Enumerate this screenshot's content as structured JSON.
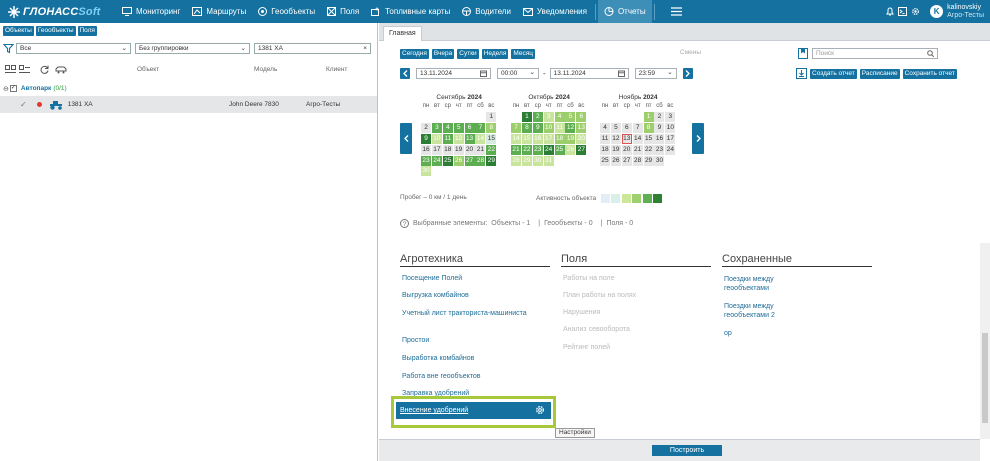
{
  "brand": {
    "name_a": "ГЛОНАСС",
    "name_b": "Soft"
  },
  "nav": [
    {
      "label": "Мониторинг",
      "icon": "monitoring-icon"
    },
    {
      "label": "Маршруты",
      "icon": "route-icon"
    },
    {
      "label": "Геообъекты",
      "icon": "geo-icon"
    },
    {
      "label": "Поля",
      "icon": "field-icon"
    },
    {
      "label": "Топливные карты",
      "icon": "fuel-card-icon"
    },
    {
      "label": "Водители",
      "icon": "steering-wheel-icon"
    },
    {
      "label": "Уведомления",
      "icon": "mail-icon"
    },
    {
      "label": "Отчеты",
      "icon": "reports-icon",
      "active": true
    }
  ],
  "user": {
    "initial": "K",
    "login": "kalinovskiy",
    "org": "Агро-Тесты"
  },
  "left": {
    "tabs": [
      "Объекты",
      "Геообъекты",
      "Поля"
    ],
    "filter": {
      "type": "Все",
      "grouping": "Без группировки",
      "search": "1381 ХА"
    },
    "columns": {
      "object": "Объект",
      "model": "Модель",
      "client": "Клиент"
    },
    "group": {
      "name": "Автопарк",
      "count": "(0/1)"
    },
    "row": {
      "name": "1381 ХА",
      "model": "John Deere 7830",
      "client": "Агро-Тесты"
    }
  },
  "right": {
    "tab": "Главная",
    "period_buttons": [
      "Сегодня",
      "Вчера",
      "Сутки",
      "Неделя",
      "Месяц"
    ],
    "shift_label": "Смены",
    "search_placeholder": "Поиск",
    "from_date": "13.11.2024",
    "from_time": "00:00",
    "to_date": "13.11.2024",
    "to_time": "23:59",
    "dash": "-",
    "actions": [
      "Создать отчет",
      "Расписание",
      "Сохранить отчет"
    ],
    "probeg": "Пробег – 0 км / 1 день",
    "activity_label": "Активность объекта",
    "activity_colors": [
      "#e4edf3",
      "#d9efe9",
      "#cbe79a",
      "#9ed070",
      "#5fb053",
      "#2e8033"
    ],
    "selected": {
      "label": "Выбранные элементы:",
      "objects": "Объекты - 1",
      "geo": "Геообъекты - 0",
      "fields": "Поля - 0",
      "sep": "|"
    },
    "build_button": "Построить",
    "tooltip": "Настройки"
  },
  "calendar": {
    "weekdays": [
      "пн",
      "вт",
      "ср",
      "чт",
      "пт",
      "сб",
      "вс"
    ],
    "months": [
      {
        "name": "Сентябрь",
        "year": "2024",
        "offset": 6,
        "days": [
          "1",
          "2",
          "3",
          "4",
          "5",
          "6",
          "7",
          "8",
          "9",
          "10",
          "11",
          "12",
          "13",
          "14",
          "15",
          "16",
          "17",
          "18",
          "19",
          "20",
          "21",
          "22",
          "23",
          "24",
          "25",
          "26",
          "27",
          "28",
          "29",
          "30"
        ],
        "levels": [
          0,
          0,
          4,
          4,
          4,
          4,
          4,
          3,
          5,
          2,
          4,
          2,
          4,
          2,
          1,
          0,
          0,
          0,
          0,
          0,
          0,
          4,
          4,
          4,
          5,
          3,
          4,
          4,
          5,
          2
        ]
      },
      {
        "name": "Октябрь",
        "year": "2024",
        "offset": 1,
        "days": [
          "1",
          "2",
          "3",
          "4",
          "5",
          "6",
          "7",
          "8",
          "9",
          "10",
          "11",
          "12",
          "13",
          "14",
          "15",
          "16",
          "17",
          "18",
          "19",
          "20",
          "21",
          "22",
          "23",
          "24",
          "25",
          "26",
          "27",
          "28",
          "29",
          "30",
          "31"
        ],
        "levels": [
          5,
          4,
          2,
          3,
          3,
          3,
          3,
          4,
          4,
          3,
          2,
          4,
          3,
          2,
          2,
          2,
          2,
          3,
          3,
          2,
          4,
          4,
          4,
          5,
          4,
          2,
          5,
          2,
          2,
          2,
          2
        ]
      },
      {
        "name": "Ноябрь",
        "year": "2024",
        "offset": 4,
        "days": [
          "1",
          "2",
          "3",
          "4",
          "5",
          "6",
          "7",
          "8",
          "9",
          "10",
          "11",
          "12",
          "13",
          "14",
          "15",
          "16",
          "17",
          "18",
          "19",
          "20",
          "21",
          "22",
          "23",
          "24",
          "25",
          "26",
          "27",
          "28",
          "29",
          "30"
        ],
        "levels": [
          3,
          0,
          0,
          0,
          0,
          0,
          0,
          3,
          0,
          0,
          0,
          0,
          0,
          0,
          0,
          0,
          0,
          0,
          0,
          0,
          0,
          0,
          0,
          0,
          0,
          0,
          0,
          0,
          0,
          0
        ],
        "today": "13"
      }
    ]
  },
  "reports": {
    "agro": {
      "title": "Агротехника",
      "items": [
        "Посещение Полей",
        "Выгрузка комбайнов",
        "Учетный лист тракториста-машиниста",
        "Простои",
        "Выработка комбайнов",
        "Работа вне геообъектов",
        "Заправка удобрений",
        "Внесение удобрений"
      ]
    },
    "fields": {
      "title": "Поля",
      "items": [
        "Работы на поле",
        "План работы на полях",
        "Нарушения",
        "Анализ севооборота",
        "Рейтинг полей"
      ]
    },
    "saved": {
      "title": "Сохраненные",
      "items": [
        "Поездки между геообъектами",
        "Поездки между геообъектами 2",
        "ор"
      ]
    }
  }
}
